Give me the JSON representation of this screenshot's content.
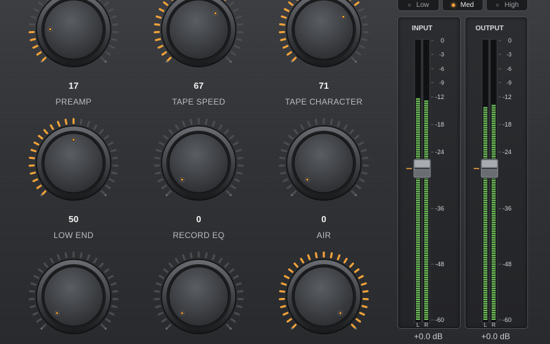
{
  "knobs": [
    {
      "id": "preamp",
      "label": "PREAMP",
      "value": "17",
      "pct": 0.17
    },
    {
      "id": "tape-speed",
      "label": "TAPE SPEED",
      "value": "67",
      "pct": 0.67
    },
    {
      "id": "tape-character",
      "label": "TAPE CHARACTER",
      "value": "71",
      "pct": 0.71
    },
    {
      "id": "low-end",
      "label": "LOW END",
      "value": "50",
      "pct": 0.5
    },
    {
      "id": "record-eq",
      "label": "RECORD EQ",
      "value": "0",
      "pct": 0.0
    },
    {
      "id": "air",
      "label": "AIR",
      "value": "0",
      "pct": 0.0
    },
    {
      "id": "knob-7",
      "label": "",
      "value": "",
      "pct": 0.0
    },
    {
      "id": "knob-8",
      "label": "",
      "value": "",
      "pct": 0.0
    },
    {
      "id": "knob-9",
      "label": "",
      "value": "",
      "pct": 1.0
    }
  ],
  "modes": {
    "options": [
      "Low",
      "Med",
      "High"
    ],
    "selected": "Med"
  },
  "meters": {
    "input": {
      "title": "INPUT",
      "readout": "+0.0 dB",
      "level_L": -12.5,
      "level_R": -13.0,
      "fader_db": -27.5
    },
    "output": {
      "title": "OUTPUT",
      "readout": "+0.0 dB",
      "level_L": -14.5,
      "level_R": -14.0,
      "fader_db": -27.5
    },
    "scale": [
      "0",
      "-3",
      "-6",
      "-9",
      "-12",
      "-18",
      "-24",
      "-36",
      "-48",
      "-60"
    ],
    "channels": [
      "L",
      "R"
    ]
  },
  "colors": {
    "accent": "#f0a23a",
    "meter_green": "#6fbf5a",
    "panel": "#2b2d30"
  }
}
